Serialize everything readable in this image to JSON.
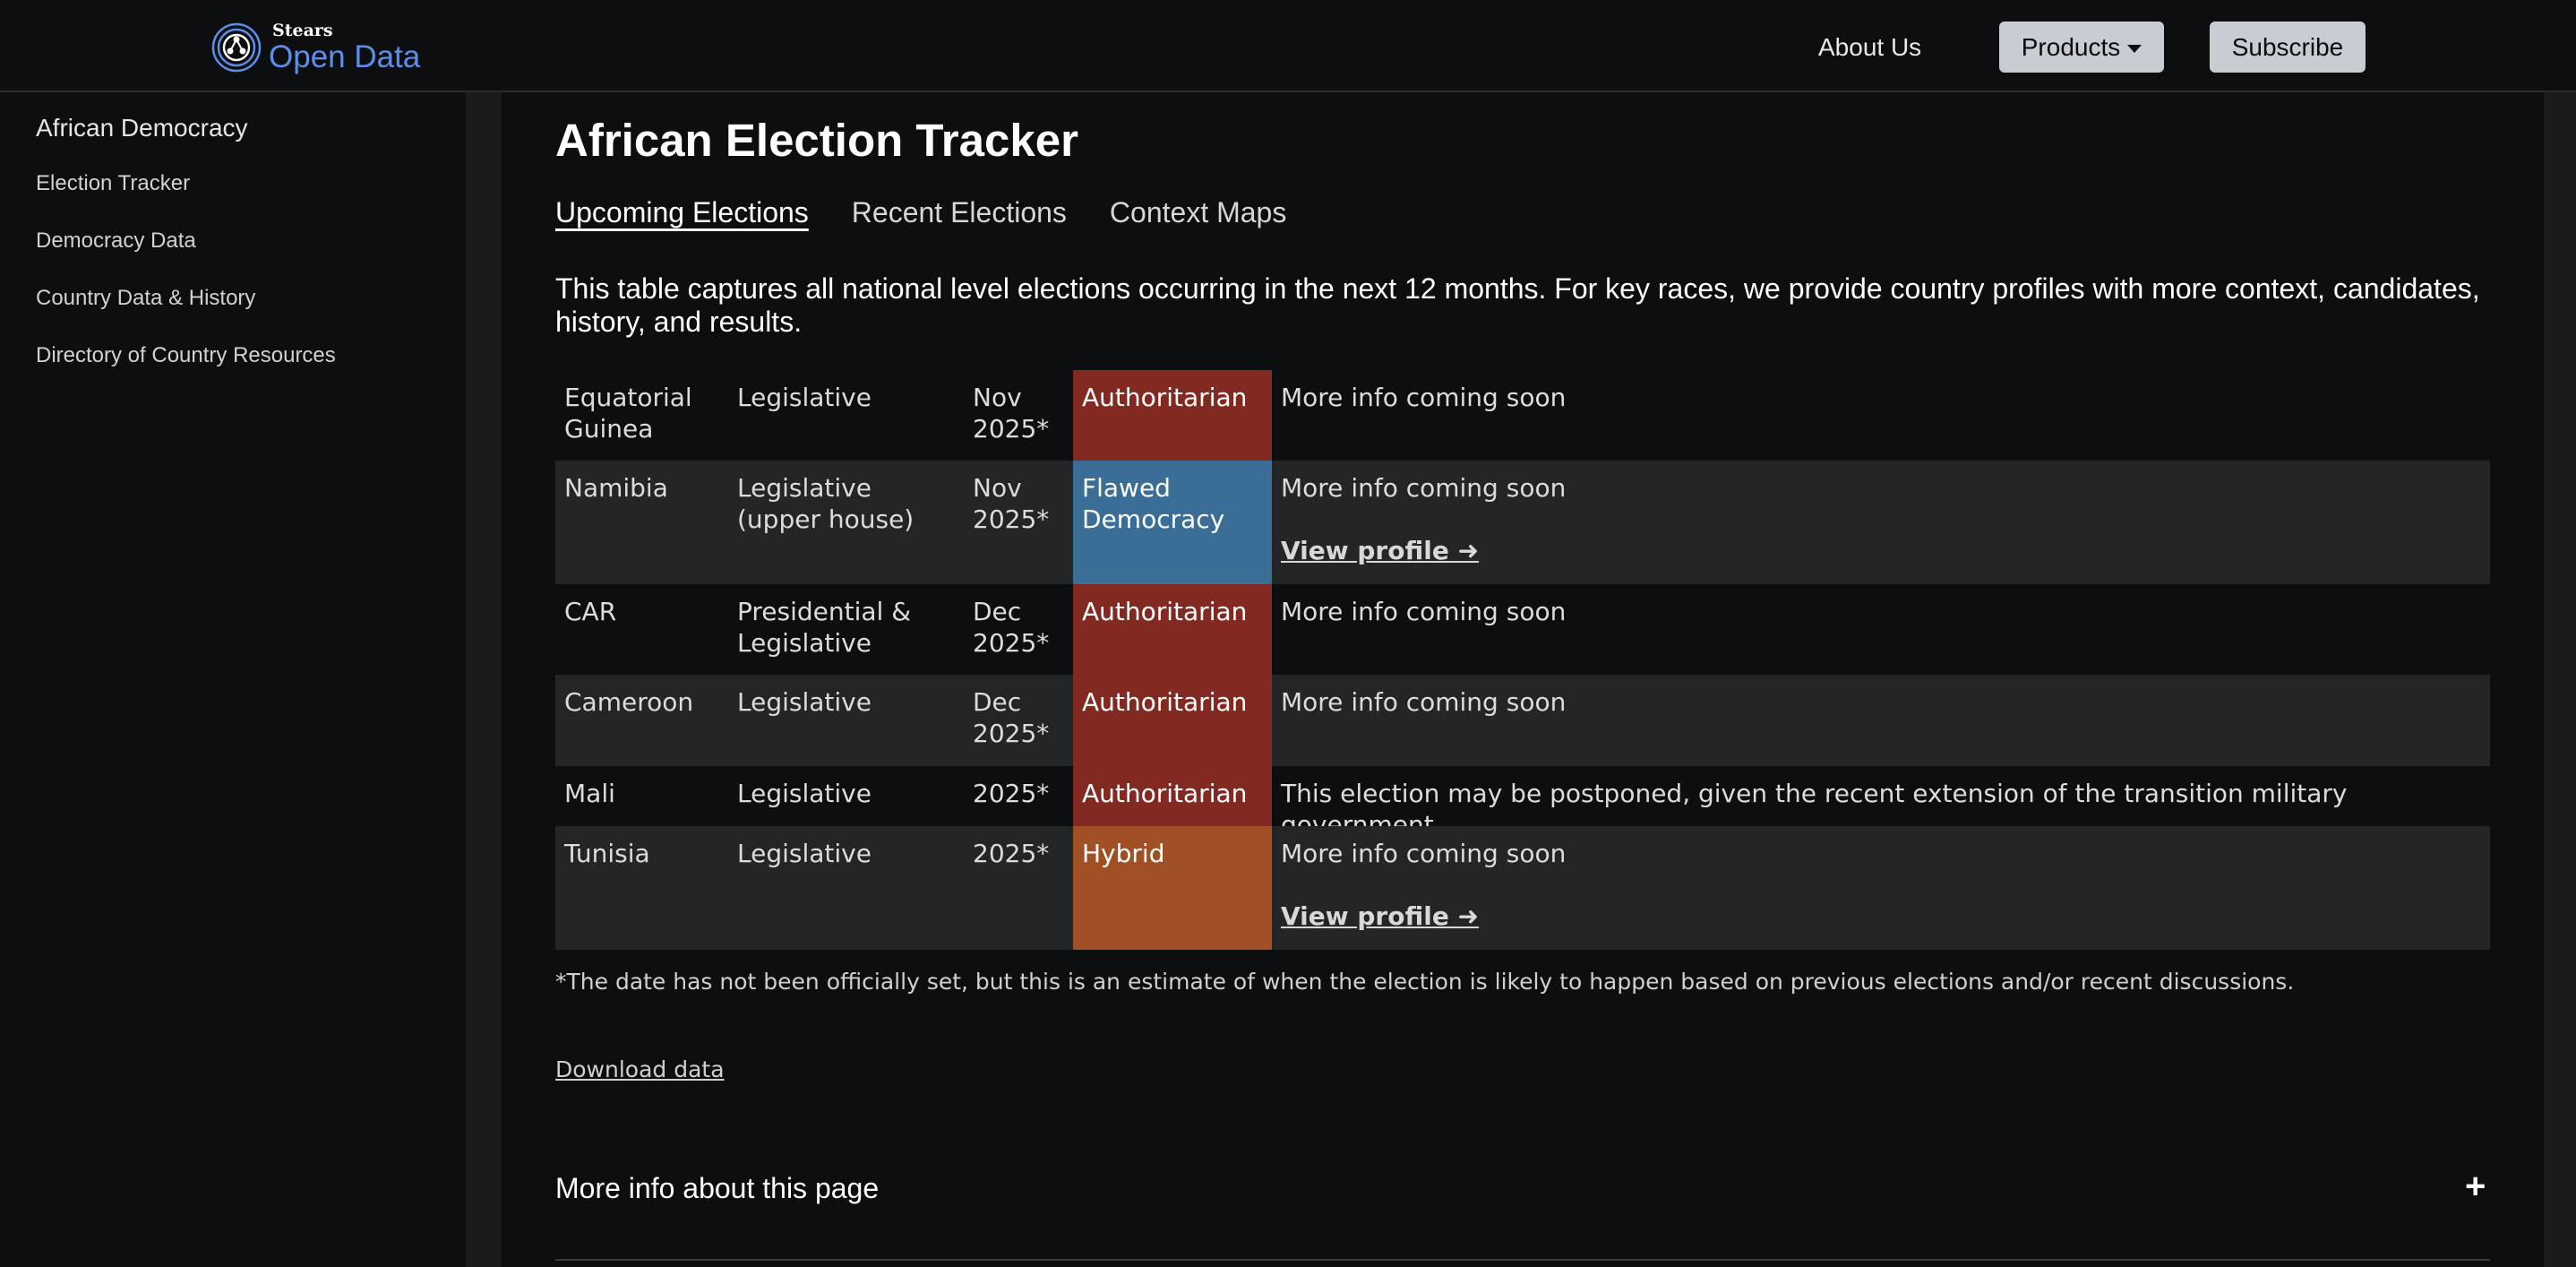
{
  "header": {
    "logo_small": "Stears",
    "logo_big": "Open Data",
    "about": "About Us",
    "products": "Products",
    "subscribe": "Subscribe"
  },
  "sidebar": {
    "title": "African Democracy",
    "items": [
      {
        "label": "Election Tracker"
      },
      {
        "label": "Democracy Data"
      },
      {
        "label": "Country Data & History"
      },
      {
        "label": "Directory of Country Resources"
      }
    ]
  },
  "main": {
    "title": "African Election Tracker",
    "tabs": [
      {
        "label": "Upcoming Elections",
        "active": true
      },
      {
        "label": "Recent Elections",
        "active": false
      },
      {
        "label": "Context Maps",
        "active": false
      }
    ],
    "intro": "This table captures all national level elections occurring in the next 12 months. For key races, we provide country profiles with more context, candidates, history, and results.",
    "rows": [
      {
        "country": "Equatorial Guinea",
        "type": "Legislative",
        "date": "Nov 2025*",
        "regime": "Authoritarian",
        "regime_color": "#822a21",
        "info": "More info coming soon",
        "profile": ""
      },
      {
        "country": "Namibia",
        "type": "Legislative (upper house)",
        "date": "Nov 2025*",
        "regime": "Flawed Democracy",
        "regime_color": "#3a6e96",
        "info": "More info coming soon",
        "profile": "View profile ➜"
      },
      {
        "country": "CAR",
        "type": "Presidential & Legislative",
        "date": "Dec 2025*",
        "regime": "Authoritarian",
        "regime_color": "#822a21",
        "info": "More info coming soon",
        "profile": ""
      },
      {
        "country": "Cameroon",
        "type": "Legislative",
        "date": "Dec 2025*",
        "regime": "Authoritarian",
        "regime_color": "#822a21",
        "info": "More info coming soon",
        "profile": ""
      },
      {
        "country": "Mali",
        "type": "Legislative",
        "date": "2025*",
        "regime": "Authoritarian",
        "regime_color": "#822a21",
        "info": "This election may be postponed, given the recent extension of the transition military government.",
        "profile": ""
      },
      {
        "country": "Tunisia",
        "type": "Legislative",
        "date": "2025*",
        "regime": "Hybrid",
        "regime_color": "#a14f25",
        "info": "More info coming soon",
        "profile": "View profile ➜"
      }
    ],
    "footnote": "*The date has not been officially set, but this is an estimate of when the election is likely to happen based on previous elections and/or recent discussions.",
    "download": "Download data",
    "more_info": "More info about this page",
    "expand_symbol": "+"
  },
  "colors": {
    "background": "#0d0e10",
    "alt_row": "#242526",
    "button": "#c8ccd3",
    "logo_blue": "#5d8ee8"
  }
}
